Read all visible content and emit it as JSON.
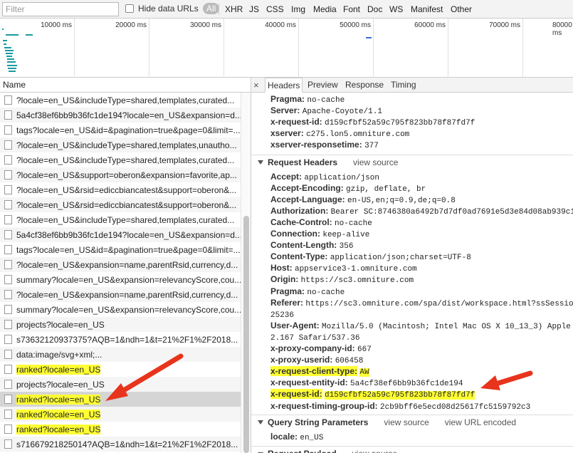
{
  "filterbar": {
    "filter_placeholder": "Filter",
    "hide_data_urls": "Hide data URLs",
    "all": "All",
    "types": [
      "XHR",
      "JS",
      "CSS",
      "Img",
      "Media",
      "Font",
      "Doc",
      "WS",
      "Manifest",
      "Other"
    ]
  },
  "overview": {
    "ticks": [
      "10000 ms",
      "20000 ms",
      "30000 ms",
      "40000 ms",
      "50000 ms",
      "60000 ms",
      "70000 ms",
      "80000 ms"
    ]
  },
  "requests": {
    "header": "Name",
    "rows": [
      {
        "name": "?locale=en_US&includeType=shared,templates,curated...",
        "hl": false
      },
      {
        "name": "5a4cf38ef6bb9b36fc1de194?locale=en_US&expansion=d...",
        "hl": false
      },
      {
        "name": "tags?locale=en_US&id=&pagination=true&page=0&limit=...",
        "hl": false
      },
      {
        "name": "?locale=en_US&includeType=shared,templates,unautho...",
        "hl": false
      },
      {
        "name": "?locale=en_US&includeType=shared,templates,curated...",
        "hl": false
      },
      {
        "name": "?locale=en_US&support=oberon&expansion=favorite,ap...",
        "hl": false
      },
      {
        "name": "?locale=en_US&rsid=ediccbiancatest&support=oberon&...",
        "hl": false
      },
      {
        "name": "?locale=en_US&rsid=ediccbiancatest&support=oberon&...",
        "hl": false
      },
      {
        "name": "?locale=en_US&includeType=shared,templates,curated...",
        "hl": false
      },
      {
        "name": "5a4cf38ef6bb9b36fc1de194?locale=en_US&expansion=d...",
        "hl": false
      },
      {
        "name": "tags?locale=en_US&id=&pagination=true&page=0&limit=...",
        "hl": false
      },
      {
        "name": "?locale=en_US&expansion=name,parentRsid,currency,d...",
        "hl": false
      },
      {
        "name": "summary?locale=en_US&expansion=relevancyScore,cou...",
        "hl": false
      },
      {
        "name": "?locale=en_US&expansion=name,parentRsid,currency,d...",
        "hl": false
      },
      {
        "name": "summary?locale=en_US&expansion=relevancyScore,cou...",
        "hl": false
      },
      {
        "name": "projects?locale=en_US",
        "hl": false
      },
      {
        "name": "s73632120937375?AQB=1&ndh=1&t=21%2F1%2F2018...",
        "hl": false
      },
      {
        "name": "data:image/svg+xml;...",
        "hl": false
      },
      {
        "name": "ranked?locale=en_US",
        "hl": true
      },
      {
        "name": "projects?locale=en_US",
        "hl": false
      },
      {
        "name": "ranked?locale=en_US",
        "hl": true
      },
      {
        "name": "ranked?locale=en_US",
        "hl": true
      },
      {
        "name": "ranked?locale=en_US",
        "hl": true
      },
      {
        "name": "s71667921825014?AQB=1&ndh=1&t=21%2F1%2F2018...",
        "hl": false
      }
    ]
  },
  "tabs": {
    "close": "×",
    "items": [
      "Headers",
      "Preview",
      "Response",
      "Timing"
    ]
  },
  "details": {
    "response_headers": [
      {
        "k": "Pragma:",
        "v": "no-cache"
      },
      {
        "k": "Server:",
        "v": "Apache-Coyote/1.1"
      },
      {
        "k": "x-request-id:",
        "v": "d159cfbf52a59c795f823bb78f87fd7f"
      },
      {
        "k": "xserver:",
        "v": "c275.lon5.omniture.com"
      },
      {
        "k": "xserver-responsetime:",
        "v": "377"
      }
    ],
    "request_headers_title": "Request Headers",
    "view_source": "view source",
    "request_headers": [
      {
        "k": "Accept:",
        "v": "application/json",
        "hl": false
      },
      {
        "k": "Accept-Encoding:",
        "v": "gzip, deflate, br",
        "hl": false
      },
      {
        "k": "Accept-Language:",
        "v": "en-US,en;q=0.9,de;q=0.8",
        "hl": false
      },
      {
        "k": "Authorization:",
        "v": "Bearer SC:8746380a6492b7d7df0ad7691e5d3e84d08ab939c1",
        "hl": false
      },
      {
        "k": "Cache-Control:",
        "v": "no-cache",
        "hl": false
      },
      {
        "k": "Connection:",
        "v": "keep-alive",
        "hl": false
      },
      {
        "k": "Content-Length:",
        "v": "356",
        "hl": false
      },
      {
        "k": "Content-Type:",
        "v": "application/json;charset=UTF-8",
        "hl": false
      },
      {
        "k": "Host:",
        "v": "appservice3-1.omniture.com",
        "hl": false
      },
      {
        "k": "Origin:",
        "v": "https://sc3.omniture.com",
        "hl": false
      },
      {
        "k": "Pragma:",
        "v": "no-cache",
        "hl": false
      },
      {
        "k": "Referer:",
        "v": "https://sc3.omniture.com/spa/dist/workspace.html?ssSession",
        "hl": false
      },
      {
        "k": "",
        "v": "25236",
        "hl": false
      },
      {
        "k": "User-Agent:",
        "v": "Mozilla/5.0 (Macintosh; Intel Mac OS X 10_13_3) Apple",
        "hl": false
      },
      {
        "k": "",
        "v": "2.167 Safari/537.36",
        "hl": false
      },
      {
        "k": "x-proxy-company-id:",
        "v": "667",
        "hl": false
      },
      {
        "k": "x-proxy-userid:",
        "v": "606458",
        "hl": false
      },
      {
        "k": "x-request-client-type:",
        "v": "AW",
        "hl": true
      },
      {
        "k": "x-request-entity-id:",
        "v": "5a4cf38ef6bb9b36fc1de194",
        "hl": false
      },
      {
        "k": "x-request-id:",
        "v": "d159cfbf52a59c795f823bb78f87fd7f",
        "hl": true
      },
      {
        "k": "x-request-timing-group-id:",
        "v": "2cb9bff6e5ecd08d25617fc5159792c3",
        "hl": false
      }
    ],
    "query_title": "Query String Parameters",
    "view_url_encoded": "view URL encoded",
    "query_params": [
      {
        "k": "locale:",
        "v": "en_US"
      }
    ],
    "payload_title": "Request Payload"
  },
  "colors": {
    "highlight": "#ffff33",
    "arrow": "#e8341c"
  }
}
